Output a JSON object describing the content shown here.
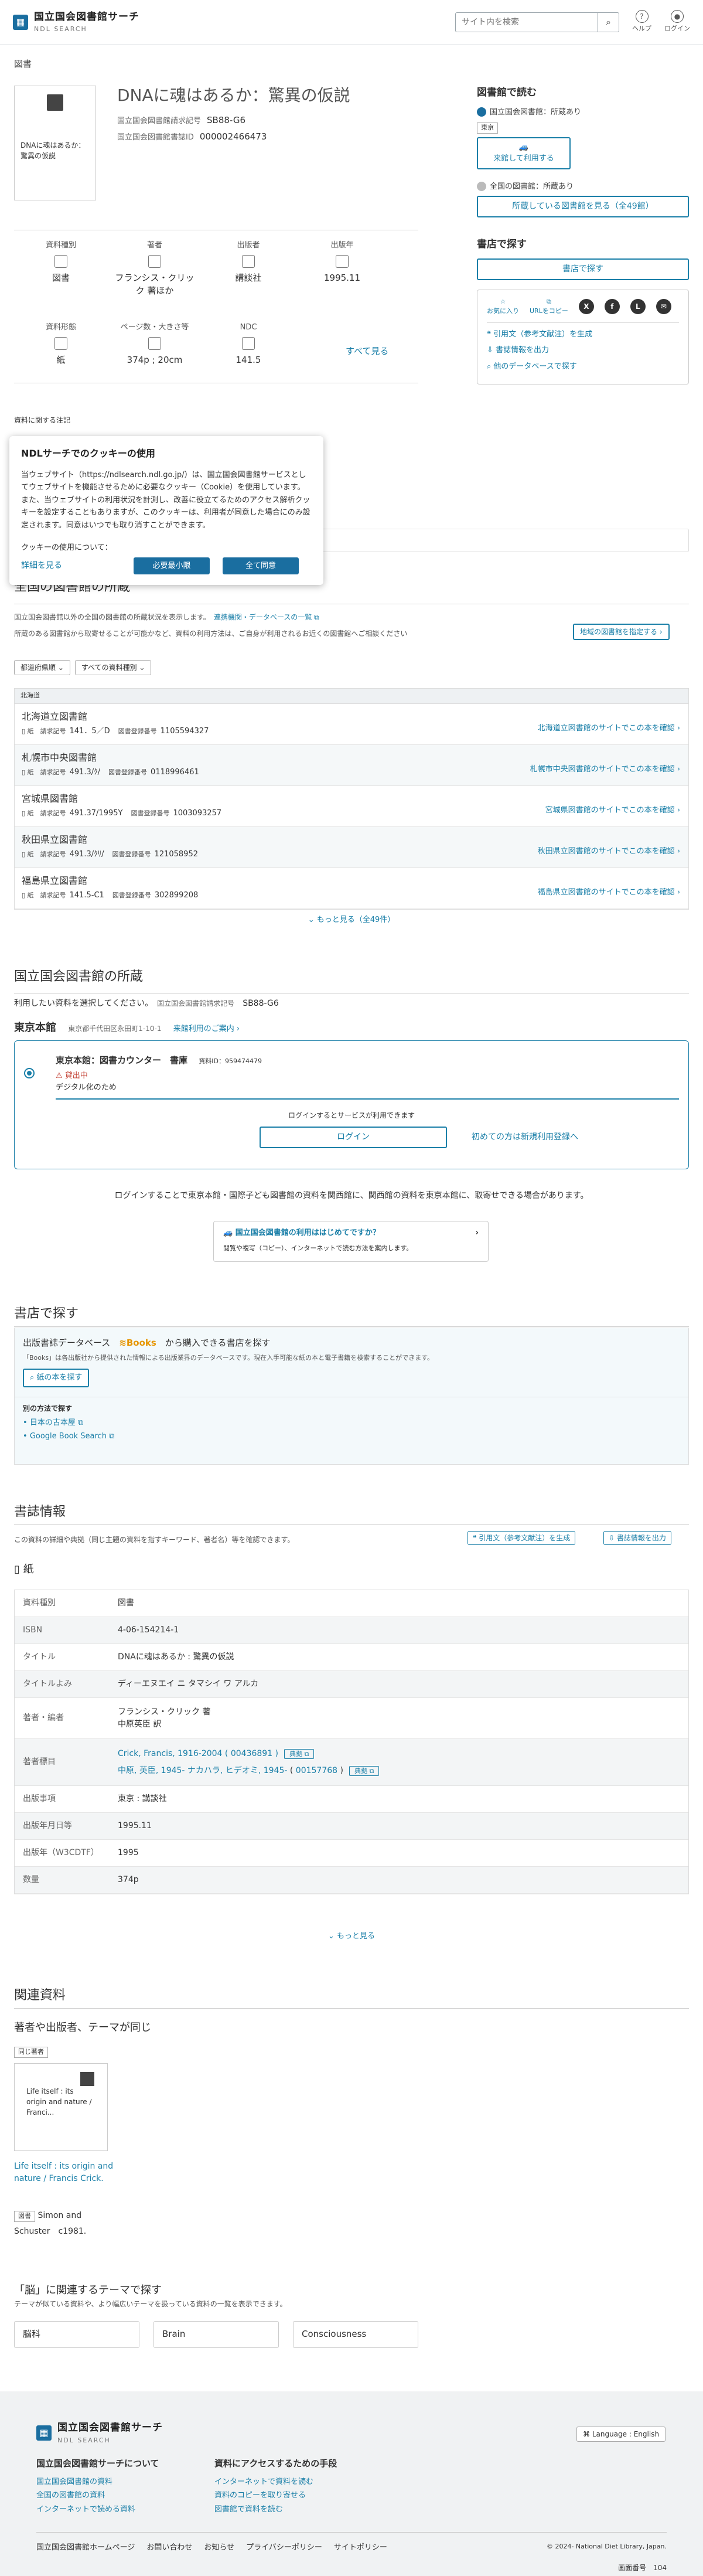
{
  "header": {
    "logo_line1": "国立国会図書館サーチ",
    "logo_line2": "NDL SEARCH",
    "search_placeholder": "サイト内を検索",
    "help": "ヘルプ",
    "login": "ログイン"
  },
  "breadcrumb": "図書",
  "item": {
    "cover_text": "DNAに魂はあるか：驚異の仮説",
    "title": "DNAに魂はあるか：驚異の仮説",
    "callno_label": "国立国会図書館請求記号",
    "callno": "SB88-G6",
    "bibid_label": "国立国会図書館書誌ID",
    "bibid": "000002466473"
  },
  "attrs": [
    {
      "label": "資料種別",
      "value": "図書"
    },
    {
      "label": "著者",
      "value": "フランシス・クリック 著ほか"
    },
    {
      "label": "出版者",
      "value": "講談社"
    },
    {
      "label": "出版年",
      "value": "1995.11"
    },
    {
      "label": "資料形態",
      "value": "紙"
    },
    {
      "label": "ページ数・大きさ等",
      "value": "374p ; 20cm"
    },
    {
      "label": "NDC",
      "value": "141.5"
    }
  ],
  "see_all": "すべて見る",
  "notes_label": "資料に関する注記",
  "right": {
    "read_title": "図書館で読む",
    "ndl_status": "国立国会図書館：所蔵あり",
    "tokyo_tag": "東京",
    "ndl_use_btn": "来館して利用する",
    "all_status": "全国の図書館：所蔵あり",
    "all_btn": "所蔵している図書館を見る（全49館）",
    "shop_title": "書店で探す",
    "shop_btn": "書店で探す",
    "bookmark": "お気に入り",
    "url_copy": "URLをコピー",
    "cite": "引用文（参考文献注）を生成",
    "output": "書誌情報を出力",
    "other_db": "他のデータベースで探す"
  },
  "cookie": {
    "title": "NDLサーチでのクッキーの使用",
    "body": "当ウェブサイト（https://ndlsearch.ndl.go.jp/）は、国立国会図書館サービスとしてウェブサイトを機能させるために必要なクッキー（Cookie）を使用しています。また、当ウェブサイトの利用状況を計測し、改善に役立てるためのアクセス解析クッキーを設定することもありますが、このクッキーは、利用者が同意した場合にのみ設定されます。同意はいつでも取り消すことができます。",
    "question": "クッキーの使用について：",
    "details": "詳細を見る",
    "necessary": "必要最小限",
    "accept": "全て同意"
  },
  "holdings": {
    "title": "全国の図書館の所蔵",
    "desc": "国立国会図書館以外の全国の図書館の所蔵状況を表示します。",
    "link": "連携機関・データベースの一覧",
    "note": "所蔵のある図書館から取寄せることが可能かなど、資料の利用方法は、ご自身が利用されるお近くの図書館へご相談ください",
    "region_btn": "地域の図書館を指定する",
    "filter1": "都道府県順",
    "filter2": "すべての資料種別",
    "region": "北海道",
    "rows": [
      {
        "name": "北海道立図書館",
        "type": "紙",
        "callno": "141．5／D",
        "regno": "1105594327",
        "link": "北海道立図書館のサイトでこの本を確認"
      },
      {
        "name": "札幌市中央図書館",
        "type": "紙",
        "callno": "491.3/ｸ/",
        "regno": "0118996461",
        "link": "札幌市中央図書館のサイトでこの本を確認"
      },
      {
        "name": "宮城県図書館",
        "type": "紙",
        "callno": "491.37/1995Y",
        "regno": "1003093257",
        "link": "宮城県図書館のサイトでこの本を確認"
      },
      {
        "name": "秋田県立図書館",
        "type": "紙",
        "callno": "491.3/ｸﾘ/",
        "regno": "121058952",
        "link": "秋田県立図書館のサイトでこの本を確認"
      },
      {
        "name": "福島県立図書館",
        "type": "紙",
        "callno": "141.5-C1",
        "regno": "302899208",
        "link": "福島県立図書館のサイトでこの本を確認"
      }
    ],
    "callno_label": "請求記号",
    "regno_label": "図書登録番号",
    "more": "もっと見る（全49件）"
  },
  "ndl": {
    "title": "国立国会図書館の所蔵",
    "desc": "利用したい資料を選択してください。",
    "callno_label": "国立国会図書館請求記号",
    "callno": "SB88-G6",
    "branch": "東京本館",
    "address": "東京都千代田区永田町1-10-1",
    "guide": "来館利用のご案内",
    "counter": "東京本館：図書カウンター　書庫",
    "bib_label": "資料ID：",
    "bib_value": "959474479",
    "status": "貸出中",
    "status_note": "デジタル化のため",
    "login_note": "ログインするとサービスが利用できます",
    "login": "ログイン",
    "register": "初めての方は新規利用登録へ",
    "info": "ログインすることで東京本館・国際子ども図書館の資料を関西館に、関西館の資料を東京本館に、取寄せできる場合があります。",
    "banner_title": "国立国会図書館の利用ははじめてですか？",
    "banner_sub": "閲覧や複写（コピー）、インターネットで読む方法を案内します。"
  },
  "shop": {
    "title": "書店で探す",
    "db_text1": "出版書誌データベース",
    "db_books": "Books",
    "db_text2": "から購入できる書店を探す",
    "db_note": "「Books」は各出版社から提供された情報による出版業界のデータベースです。現在入手可能な紙の本と電子書籍を検索することができます。",
    "btn": "紙の本を探す",
    "other": "別の方法で探す",
    "alt1": "日本の古本屋",
    "alt2": "Google Book Search"
  },
  "bib": {
    "title": "書誌情報",
    "desc": "この資料の詳細や典拠（同じ主題の資料を指すキーワード、著者名）等を確認できます。",
    "cite": "引用文（参考文献注）を生成",
    "output": "書誌情報を出力",
    "form": "紙",
    "rows": [
      {
        "k": "資料種別",
        "v": "図書"
      },
      {
        "k": "ISBN",
        "v": "4-06-154214-1"
      },
      {
        "k": "タイトル",
        "v": "DNAに魂はあるか : 驚異の仮説"
      },
      {
        "k": "タイトルよみ",
        "v": "ディーエヌエイ ニ タマシイ ワ アルカ"
      },
      {
        "k": "著者・編者",
        "v": "フランシス・クリック 著"
      },
      {
        "k": "著者標目",
        "v": "Crick, Francis, 1916-2004"
      },
      {
        "k": "出版事項",
        "v": "東京 : 講談社"
      },
      {
        "k": "出版年月日等",
        "v": "1995.11"
      },
      {
        "k": "出版年（W3CDTF）",
        "v": "1995"
      },
      {
        "k": "数量",
        "v": "374p"
      }
    ],
    "author2": "中原英臣 訳",
    "heading1_id": "00436891",
    "heading2": "中原, 英臣, 1945- ナカハラ, ヒデオミ, 1945-",
    "heading2_id": "00157768",
    "authority": "典拠",
    "more": "もっと見る"
  },
  "related": {
    "title": "関連資料",
    "sub": "著者や出版者、テーマが同じ",
    "tag": "同じ著者",
    "cover_text": "Life itself : its origin and nature / Franci...",
    "link": "Life itself : its origin and nature / Francis Crick.",
    "type": "図書",
    "pub": "Simon and Schuster　c1981."
  },
  "themes": {
    "title": "「脳」に関連するテーマで探す",
    "desc": "テーマが似ている資料や、より幅広いテーマを扱っている資料の一覧を表示できます。",
    "items": [
      "脳科",
      "Brain",
      "Consciousness"
    ]
  },
  "footer": {
    "lang": "Language : English",
    "col1_title": "国立国会図書館サーチについて",
    "col1": [
      "国立国会図書館の資料",
      "全国の図書館の資料",
      "インターネットで読める資料"
    ],
    "col2_title": "資料にアクセスするための手段",
    "col2": [
      "インターネットで資料を読む",
      "資料のコピーを取り寄せる",
      "図書館で資料を読む"
    ],
    "links": [
      "国立国会図書館ホームページ",
      "お問い合わせ",
      "お知らせ",
      "プライバシーポリシー",
      "サイトポリシー"
    ],
    "copyright": "© 2024- National Diet Library, Japan.",
    "page_no_label": "画面番号",
    "page_no": "104"
  }
}
